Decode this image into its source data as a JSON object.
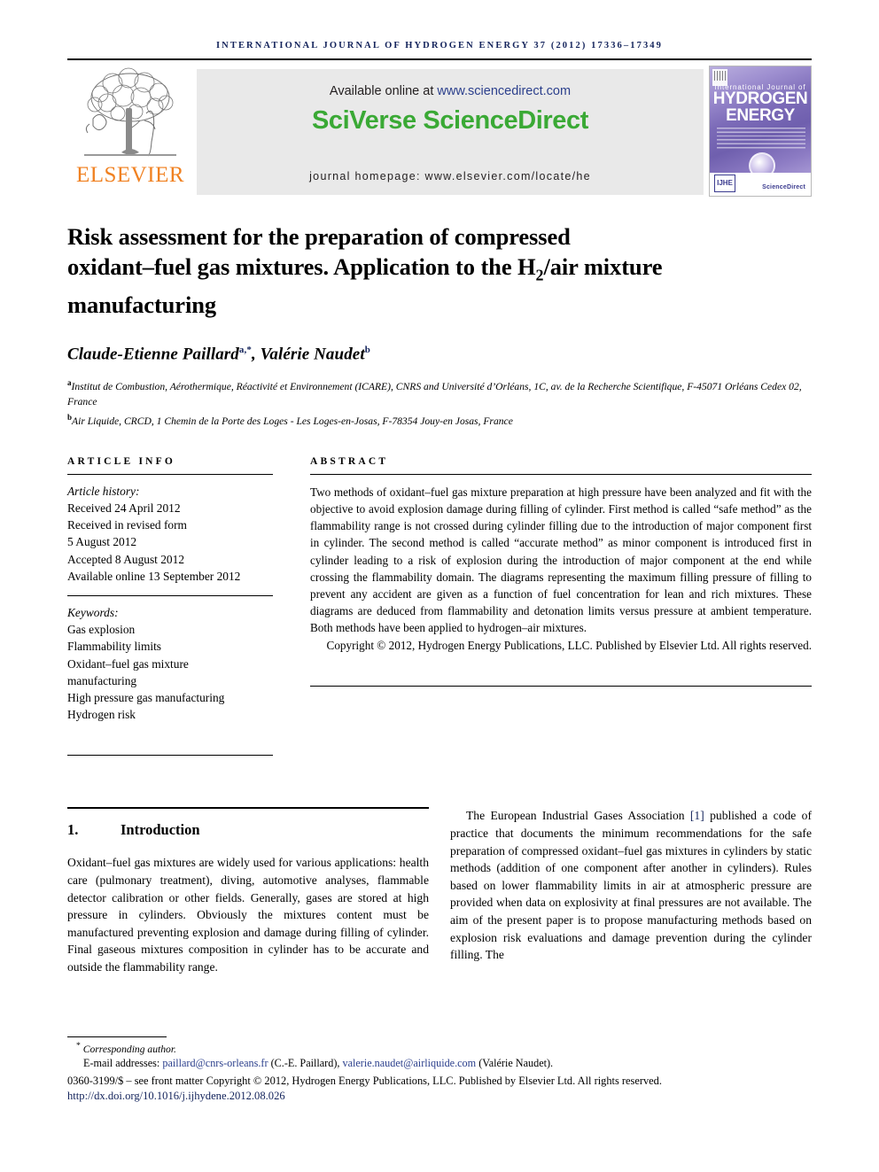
{
  "running_head": "International Journal of Hydrogen Energy 37 (2012) 17336–17349",
  "masthead": {
    "publisher_name": "ELSEVIER",
    "publisher_logo_icon": "elsevier-tree-logo",
    "available_online_prefix": "Available online at ",
    "available_online_url": "www.sciencedirect.com",
    "sciverse": "SciVerse",
    "sciencedirect": "ScienceDirect",
    "journal_homepage": "journal homepage: www.elsevier.com/locate/he",
    "cover": {
      "kicker": "International Journal of",
      "line1": "HYDROGEN",
      "line2": "ENERGY",
      "badge": "IJHE",
      "footer_brand": "ScienceDirect"
    }
  },
  "article": {
    "title_line1": "Risk assessment for the preparation of compressed",
    "title_line2_a": "oxidant–fuel gas mixtures. Application to the H",
    "title_line2_sub": "2",
    "title_line2_b": "/air mixture",
    "title_line3": "manufacturing",
    "authors": {
      "a1_name": "Claude-Etienne Paillard",
      "a1_sup": "a,*",
      "separator": ", ",
      "a2_name": "Valérie Naudet",
      "a2_sup": "b"
    },
    "affiliations": [
      {
        "marker": "a",
        "text": "Institut de Combustion, Aérothermique, Réactivité et Environnement (ICARE), CNRS and Université d’Orléans, 1C, av. de la Recherche Scientifique, F-45071 Orléans Cedex 02, France"
      },
      {
        "marker": "b",
        "text": "Air Liquide, CRCD, 1 Chemin de la Porte des Loges - Les Loges-en-Josas, F-78354 Jouy-en Josas, France"
      }
    ]
  },
  "article_info": {
    "heading": "ARTICLE INFO",
    "history_label": "Article history:",
    "history": [
      "Received 24 April 2012",
      "Received in revised form",
      "5 August 2012",
      "Accepted 8 August 2012",
      "Available online 13 September 2012"
    ],
    "keywords_label": "Keywords:",
    "keywords": [
      "Gas explosion",
      "Flammability limits",
      "Oxidant–fuel gas mixture",
      "manufacturing",
      "High pressure gas manufacturing",
      "Hydrogen risk"
    ]
  },
  "abstract": {
    "heading": "ABSTRACT",
    "body": "Two methods of oxidant–fuel gas mixture preparation at high pressure have been analyzed and fit with the objective to avoid explosion damage during filling of cylinder. First method is called “safe method” as the flammability range is not crossed during cylinder filling due to the introduction of major component first in cylinder. The second method is called “accurate method” as minor component is introduced first in cylinder leading to a risk of explosion during the introduction of major component at the end while crossing the flammability domain. The diagrams representing the maximum filling pressure of filling to prevent any accident are given as a function of fuel concentration for lean and rich mixtures. These diagrams are deduced from flammability and detonation limits versus pressure at ambient temperature. Both methods have been applied to hydrogen–air mixtures.",
    "copyright": "Copyright © 2012, Hydrogen Energy Publications, LLC. Published by Elsevier Ltd. All rights reserved."
  },
  "section": {
    "number": "1.",
    "title": "Introduction",
    "left_paragraph": "Oxidant–fuel gas mixtures are widely used for various applications: health care (pulmonary treatment), diving, automotive analyses, flammable detector calibration or other fields. Generally, gases are stored at high pressure in cylinders. Obviously the mixtures content must be manufactured preventing explosion and damage during filling of cylinder. Final gaseous mixtures composition in cylinder has to be accurate and outside the flammability range.",
    "right_paragraph_a": "The European Industrial Gases Association ",
    "right_citation": "[1]",
    "right_paragraph_b": " published a code of practice that documents the minimum recommendations for the safe preparation of compressed oxidant–fuel gas mixtures in cylinders by static methods (addition of one component after another in cylinders). Rules based on lower flammability limits in air at atmospheric pressure are provided when data on explosivity at final pressures are not available. The aim of the present paper is to propose manufacturing methods based on explosion risk evaluations and damage prevention during the cylinder filling. The"
  },
  "footer": {
    "corresponding_marker": "*",
    "corresponding_label": "Corresponding author.",
    "email_label": "E-mail addresses: ",
    "email1": "paillard@cnrs-orleans.fr",
    "email1_owner": " (C.-E. Paillard), ",
    "email2": "valerie.naudet@airliquide.com",
    "email2_owner": " (Valérie Naudet).",
    "issn_line": "0360-3199/$ – see front matter Copyright © 2012, Hydrogen Energy Publications, LLC. Published by Elsevier Ltd. All rights reserved.",
    "doi": "http://dx.doi.org/10.1016/j.ijhydene.2012.08.026"
  },
  "colors": {
    "accent_link": "#2b3f8c",
    "elsevier_orange": "#f08121",
    "sciencedirect_green": "#3aa935",
    "running_head": "#13235b"
  }
}
